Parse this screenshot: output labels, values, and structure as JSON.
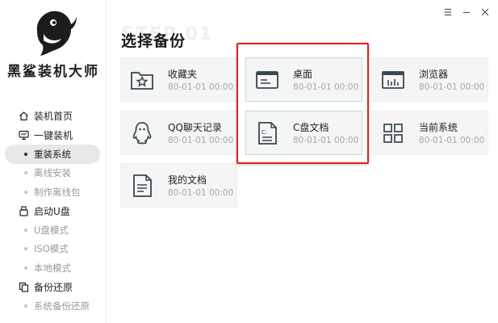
{
  "app": {
    "logo_text": "黑鲨装机大师"
  },
  "window_controls": {
    "menu_icon": "menu-icon",
    "minimize_icon": "minimize-icon",
    "close_icon": "close-icon"
  },
  "sidebar": {
    "items": [
      {
        "type": "group",
        "label": "装机首页",
        "icon": "home-icon"
      },
      {
        "type": "group",
        "label": "一键装机",
        "icon": "monitor-icon"
      },
      {
        "type": "sub",
        "label": "重装系统",
        "active": true
      },
      {
        "type": "sub",
        "label": "离线安装"
      },
      {
        "type": "sub",
        "label": "制作离线包"
      },
      {
        "type": "group",
        "label": "启动U盘",
        "icon": "usb-icon"
      },
      {
        "type": "sub",
        "label": "U盘模式"
      },
      {
        "type": "sub",
        "label": "ISO模式"
      },
      {
        "type": "sub",
        "label": "本地模式"
      },
      {
        "type": "group",
        "label": "备份还原",
        "icon": "backup-icon"
      },
      {
        "type": "sub",
        "label": "系统备份还原"
      }
    ]
  },
  "main": {
    "watermark": "STEP 01",
    "title": "选择备份",
    "cards": [
      {
        "name": "收藏夹",
        "date": "80-01-01 00:00",
        "icon": "favorites-folder-icon",
        "selected": false
      },
      {
        "name": "桌面",
        "date": "80-01-01 00:00",
        "icon": "desktop-icon",
        "selected": true
      },
      {
        "name": "浏览器",
        "date": "80-01-01 00:00",
        "icon": "browser-icon",
        "selected": false
      },
      {
        "name": "QQ聊天记录",
        "date": "80-01-01 00:00",
        "icon": "qq-icon",
        "selected": false
      },
      {
        "name": "C盘文档",
        "date": "80-01-01 00:00",
        "icon": "c-drive-document-icon",
        "selected": true
      },
      {
        "name": "当前系统",
        "date": "80-01-01 00:00",
        "icon": "system-grid-icon",
        "selected": false
      },
      {
        "name": "我的文档",
        "date": "80-01-01 00:00",
        "icon": "my-documents-icon",
        "selected": false
      }
    ]
  },
  "colors": {
    "highlight_border": "#e02020",
    "selected_card_border": "#c7d9d4",
    "icon_color": "#37474f"
  }
}
